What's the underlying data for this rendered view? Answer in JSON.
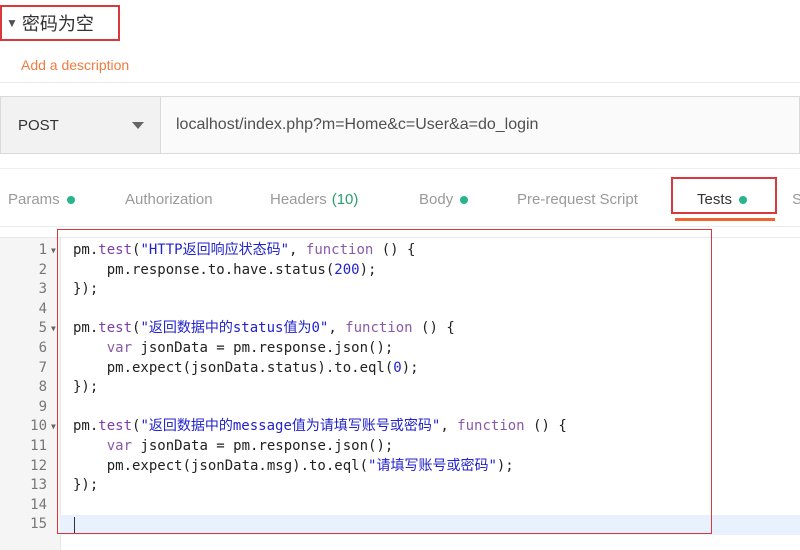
{
  "request": {
    "title": "密码为空",
    "add_description": "Add a description"
  },
  "url_bar": {
    "method": "POST",
    "url": "localhost/index.php?m=Home&c=User&a=do_login"
  },
  "tabs": [
    {
      "label": "Params",
      "has_dot": true
    },
    {
      "label": "Authorization",
      "has_dot": false
    },
    {
      "label": "Headers",
      "count": "(10)",
      "has_dot": false
    },
    {
      "label": "Body",
      "has_dot": true
    },
    {
      "label": "Pre-request Script",
      "has_dot": false
    },
    {
      "label": "Tests",
      "has_dot": true,
      "active": true
    }
  ],
  "tab_overflow": "S",
  "colors": {
    "accent": "#f06431",
    "dot": "#28b48c",
    "highlight_box": "#d9383c"
  },
  "editor": {
    "line_numbers": [
      "1",
      "2",
      "3",
      "4",
      "5",
      "6",
      "7",
      "8",
      "9",
      "10",
      "11",
      "12",
      "13",
      "14",
      "15"
    ],
    "lines": [
      [
        {
          "t": "pm.",
          "c": "k-obj"
        },
        {
          "t": "test",
          "c": "k-fn"
        },
        {
          "t": "(",
          "c": "k-obj"
        },
        {
          "t": "\"HTTP返回响应状态码\"",
          "c": "k-str"
        },
        {
          "t": ", ",
          "c": "k-obj"
        },
        {
          "t": "function",
          "c": "k-kw"
        },
        {
          "t": " () {",
          "c": "k-obj"
        }
      ],
      [
        {
          "t": "    pm.response.to.have.status(",
          "c": "k-obj"
        },
        {
          "t": "200",
          "c": "k-num"
        },
        {
          "t": ");",
          "c": "k-obj"
        }
      ],
      [
        {
          "t": "});",
          "c": "k-obj"
        }
      ],
      [],
      [
        {
          "t": "pm.",
          "c": "k-obj"
        },
        {
          "t": "test",
          "c": "k-fn"
        },
        {
          "t": "(",
          "c": "k-obj"
        },
        {
          "t": "\"返回数据中的status值为0\"",
          "c": "k-str"
        },
        {
          "t": ", ",
          "c": "k-obj"
        },
        {
          "t": "function",
          "c": "k-kw"
        },
        {
          "t": " () {",
          "c": "k-obj"
        }
      ],
      [
        {
          "t": "    ",
          "c": "k-obj"
        },
        {
          "t": "var",
          "c": "k-kw"
        },
        {
          "t": " jsonData = pm.response.json();",
          "c": "k-obj"
        }
      ],
      [
        {
          "t": "    pm.expect(jsonData.status).to.eql(",
          "c": "k-obj"
        },
        {
          "t": "0",
          "c": "k-num"
        },
        {
          "t": ");",
          "c": "k-obj"
        }
      ],
      [
        {
          "t": "});",
          "c": "k-obj"
        }
      ],
      [],
      [
        {
          "t": "pm.",
          "c": "k-obj"
        },
        {
          "t": "test",
          "c": "k-fn"
        },
        {
          "t": "(",
          "c": "k-obj"
        },
        {
          "t": "\"返回数据中的message值为请填写账号或密码\"",
          "c": "k-str"
        },
        {
          "t": ", ",
          "c": "k-obj"
        },
        {
          "t": "function",
          "c": "k-kw"
        },
        {
          "t": " () {",
          "c": "k-obj"
        }
      ],
      [
        {
          "t": "    ",
          "c": "k-obj"
        },
        {
          "t": "var",
          "c": "k-kw"
        },
        {
          "t": " jsonData = pm.response.json();",
          "c": "k-obj"
        }
      ],
      [
        {
          "t": "    pm.expect(jsonData.msg).to.eql(",
          "c": "k-obj"
        },
        {
          "t": "\"请填写账号或密码\"",
          "c": "k-str"
        },
        {
          "t": ");",
          "c": "k-obj"
        }
      ],
      [
        {
          "t": "});",
          "c": "k-obj"
        }
      ],
      [],
      []
    ],
    "fold_lines": [
      1,
      5,
      10
    ],
    "active_line": 15
  }
}
